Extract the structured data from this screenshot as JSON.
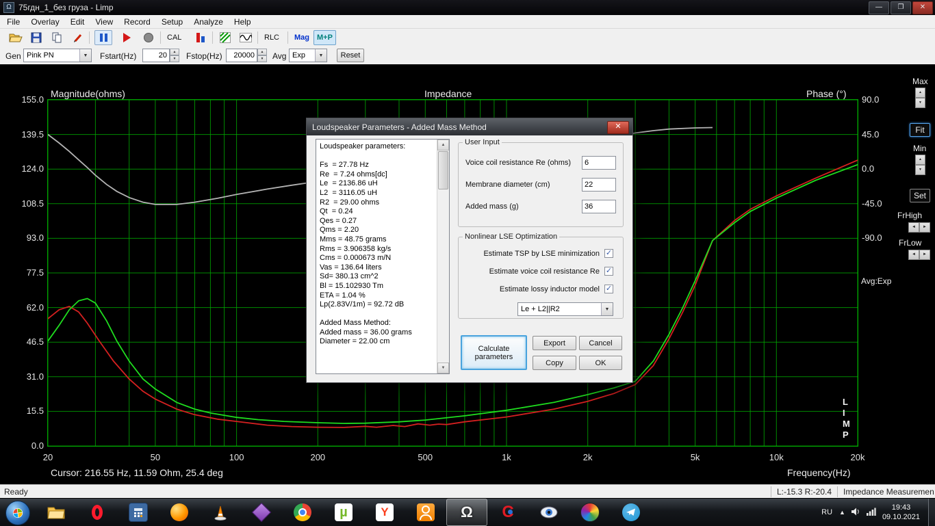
{
  "window": {
    "title": "75гдн_1_без груза - Limp",
    "icon_glyph": "Ω",
    "controls": {
      "minimize": "—",
      "maximize": "❐",
      "close": "✕"
    }
  },
  "menu": [
    "File",
    "Overlay",
    "Edit",
    "View",
    "Record",
    "Setup",
    "Analyze",
    "Help"
  ],
  "toolbar": {
    "icon_names": [
      "open-icon",
      "save-icon",
      "copy-icon",
      "pen-icon",
      "pause-icon",
      "play-icon",
      "record-icon",
      "spectrum-icon",
      "generator-icon",
      "sine-icon"
    ],
    "cal_label": "CAL",
    "rlc_label": "RLC",
    "mag_label": "Mag",
    "mp_label": "M+P"
  },
  "genbar": {
    "gen_label": "Gen",
    "gen_value": "Pink PN",
    "fstart_label": "Fstart(Hz)",
    "fstart_value": "20",
    "fstop_label": "Fstop(Hz)",
    "fstop_value": "20000",
    "avg_label": "Avg",
    "avg_value": "Exp",
    "reset_label": "Reset"
  },
  "chart": {
    "title": "Impedance",
    "left_axis_label": "Magnitude(ohms)",
    "right_axis_label": "Phase (°)",
    "x_axis_label": "Frequency(Hz)",
    "cursor_text": "Cursor: 216.55 Hz, 11.59 Ohm, 25.4 deg",
    "left_ticks": [
      "155.0",
      "139.5",
      "124.0",
      "108.5",
      "93.0",
      "77.5",
      "62.0",
      "46.5",
      "31.0",
      "15.5",
      "0.0"
    ],
    "right_ticks": [
      "90.0",
      "45.0",
      "0.0",
      "-45.0",
      "-90.0"
    ],
    "x_ticks": [
      "20",
      "50",
      "100",
      "200",
      "500",
      "1k",
      "2k",
      "5k",
      "10k",
      "20k"
    ],
    "limp_text": "L\nI\nM\nP"
  },
  "side_panel": {
    "max_label": "Max",
    "fit_label": "Fit",
    "min_label": "Min",
    "set_label": "Set",
    "frhigh_label": "FrHigh",
    "frlow_label": "FrLow",
    "avg_text": "Avg:Exp"
  },
  "chart_data": {
    "type": "line",
    "x_scale": "log",
    "xlim": [
      20,
      20000
    ],
    "ylim_left": [
      0,
      155
    ],
    "phase_ticks": [
      90,
      45,
      0,
      -45,
      -90
    ],
    "x_major_ticks": [
      20,
      50,
      100,
      200,
      500,
      1000,
      2000,
      5000,
      10000,
      20000
    ],
    "left_tick_values": [
      155,
      139.5,
      124,
      108.5,
      93,
      77.5,
      62,
      46.5,
      31,
      15.5,
      0
    ],
    "grid_freqs": [
      20,
      30,
      40,
      50,
      60,
      70,
      80,
      90,
      100,
      200,
      300,
      400,
      500,
      600,
      700,
      800,
      900,
      1000,
      2000,
      3000,
      4000,
      5000,
      6000,
      7000,
      8000,
      9000,
      10000,
      20000
    ],
    "series": [
      {
        "name": "phase",
        "axis": "phase",
        "color": "#b4b4b4",
        "points": [
          [
            20,
            45
          ],
          [
            22,
            34
          ],
          [
            24,
            23
          ],
          [
            26,
            12
          ],
          [
            28,
            2
          ],
          [
            30,
            -8
          ],
          [
            33,
            -20
          ],
          [
            36,
            -29
          ],
          [
            40,
            -37
          ],
          [
            45,
            -43
          ],
          [
            50,
            -46
          ],
          [
            60,
            -46
          ],
          [
            70,
            -43
          ],
          [
            85,
            -38
          ],
          [
            100,
            -33
          ],
          [
            130,
            -26
          ],
          [
            160,
            -21
          ],
          [
            200,
            -16
          ],
          [
            250,
            -12
          ],
          [
            300,
            -9
          ],
          [
            400,
            -4
          ],
          [
            500,
            0
          ],
          [
            700,
            8
          ],
          [
            1000,
            18
          ],
          [
            1500,
            28
          ],
          [
            2000,
            36
          ],
          [
            2500,
            42
          ],
          [
            3000,
            47
          ],
          [
            3500,
            50
          ],
          [
            4000,
            52
          ],
          [
            5000,
            53.5
          ],
          [
            5800,
            54
          ]
        ]
      },
      {
        "name": "overlay-magnitude",
        "axis": "left",
        "color": "#d42020",
        "points": [
          [
            20,
            57
          ],
          [
            22,
            61
          ],
          [
            24,
            62.5
          ],
          [
            26,
            60
          ],
          [
            28,
            55
          ],
          [
            31,
            47
          ],
          [
            35,
            38
          ],
          [
            40,
            30
          ],
          [
            45,
            24.5
          ],
          [
            50,
            21
          ],
          [
            60,
            16.5
          ],
          [
            70,
            14
          ],
          [
            85,
            12
          ],
          [
            100,
            11
          ],
          [
            130,
            9.3
          ],
          [
            160,
            8.7
          ],
          [
            200,
            8.4
          ],
          [
            250,
            8.3
          ],
          [
            300,
            8.8
          ],
          [
            330,
            8.4
          ],
          [
            380,
            9.2
          ],
          [
            420,
            8.7
          ],
          [
            470,
            9.9
          ],
          [
            520,
            9.3
          ],
          [
            560,
            9.8
          ],
          [
            600,
            9.6
          ],
          [
            700,
            10.8
          ],
          [
            1000,
            13
          ],
          [
            1500,
            16.5
          ],
          [
            2000,
            20
          ],
          [
            2500,
            23.5
          ],
          [
            3000,
            27.5
          ],
          [
            3500,
            36
          ],
          [
            4000,
            48
          ],
          [
            4500,
            60
          ],
          [
            5000,
            72
          ],
          [
            5800,
            92
          ],
          [
            7000,
            101
          ],
          [
            8000,
            106
          ],
          [
            10000,
            112
          ],
          [
            14000,
            120
          ],
          [
            20000,
            128
          ]
        ]
      },
      {
        "name": "impedance-magnitude",
        "axis": "left",
        "color": "#1fdd1f",
        "points": [
          [
            20,
            47
          ],
          [
            22,
            54
          ],
          [
            24,
            61
          ],
          [
            26,
            65
          ],
          [
            28,
            66
          ],
          [
            30,
            64
          ],
          [
            33,
            56
          ],
          [
            36,
            47
          ],
          [
            40,
            38
          ],
          [
            45,
            30
          ],
          [
            50,
            25.5
          ],
          [
            60,
            19.5
          ],
          [
            70,
            16.5
          ],
          [
            80,
            14.8
          ],
          [
            100,
            12.8
          ],
          [
            120,
            11.8
          ],
          [
            150,
            11
          ],
          [
            200,
            10.4
          ],
          [
            250,
            10.1
          ],
          [
            300,
            10.2
          ],
          [
            400,
            10.8
          ],
          [
            500,
            11.6
          ],
          [
            700,
            13.5
          ],
          [
            1000,
            16
          ],
          [
            1500,
            19.5
          ],
          [
            2000,
            23
          ],
          [
            2500,
            26
          ],
          [
            3000,
            29
          ],
          [
            3500,
            38
          ],
          [
            4000,
            50
          ],
          [
            4500,
            62
          ],
          [
            5000,
            74
          ],
          [
            5800,
            92
          ],
          [
            7000,
            100
          ],
          [
            8000,
            105
          ],
          [
            10000,
            111
          ],
          [
            14000,
            119
          ],
          [
            20000,
            126
          ]
        ]
      }
    ]
  },
  "dialog": {
    "title": "Loudspeaker Parameters - Added Mass Method",
    "params_text": "Loudspeaker parameters:\n\nFs  = 27.78 Hz\nRe  = 7.24 ohms[dc]\nLe  = 2136.86 uH\nL2  = 3116.05 uH\nR2  = 29.00 ohms\nQt  = 0.24\nQes = 0.27\nQms = 2.20\nMms = 48.75 grams\nRms = 3.906358 kg/s\nCms = 0.000673 m/N\nVas = 136.64 liters\nSd= 380.13 cm^2\nBl = 15.102930 Tm\nETA = 1.04 %\nLp(2.83V/1m) = 92.72 dB\n\nAdded Mass Method:\nAdded mass = 36.00 grams\nDiameter = 22.00 cm",
    "user_input": {
      "group_label": "User Input",
      "fields": [
        {
          "label": "Voice coil resistance Re (ohms)",
          "value": "6"
        },
        {
          "label": "Membrane diameter (cm)",
          "value": "22"
        },
        {
          "label": "Added mass (g)",
          "value": "36"
        }
      ]
    },
    "lse": {
      "group_label": "Nonlinear LSE Optimization",
      "checkboxes": [
        {
          "label": "Estimate TSP by LSE minimization",
          "checked": true
        },
        {
          "label": "Estimate voice coil resistance Re",
          "checked": true
        },
        {
          "label": "Estimate lossy inductor model",
          "checked": true
        }
      ],
      "dropdown_value": "Le + L2||R2"
    },
    "buttons": {
      "calculate": "Calculate parameters",
      "export": "Export",
      "cancel": "Cancel",
      "copy": "Copy",
      "ok": "OK"
    }
  },
  "statusbar": {
    "left": "Ready",
    "levels": "L:-15.3   R:-20.4",
    "mode": "Impedance Measuremen"
  },
  "taskbar": {
    "icons": [
      "start",
      "explorer-folder",
      "opera",
      "calculator",
      "firefox",
      "vlc",
      "gem-app",
      "chrome",
      "utorrent",
      "yandex-browser",
      "odnoklassniki",
      "limp-omega",
      "arta-c",
      "eye-app",
      "color-sphere",
      "telegram"
    ],
    "active_icon": "limp-omega",
    "tray": {
      "lang": "RU",
      "time": "19:43",
      "date": "09.10.2021"
    }
  },
  "colors": {
    "grid": "#00a400",
    "magnitude": "#1fdd1f",
    "overlay": "#d42020",
    "phase": "#b4b4b4",
    "accent_blue": "#49a3dd"
  }
}
